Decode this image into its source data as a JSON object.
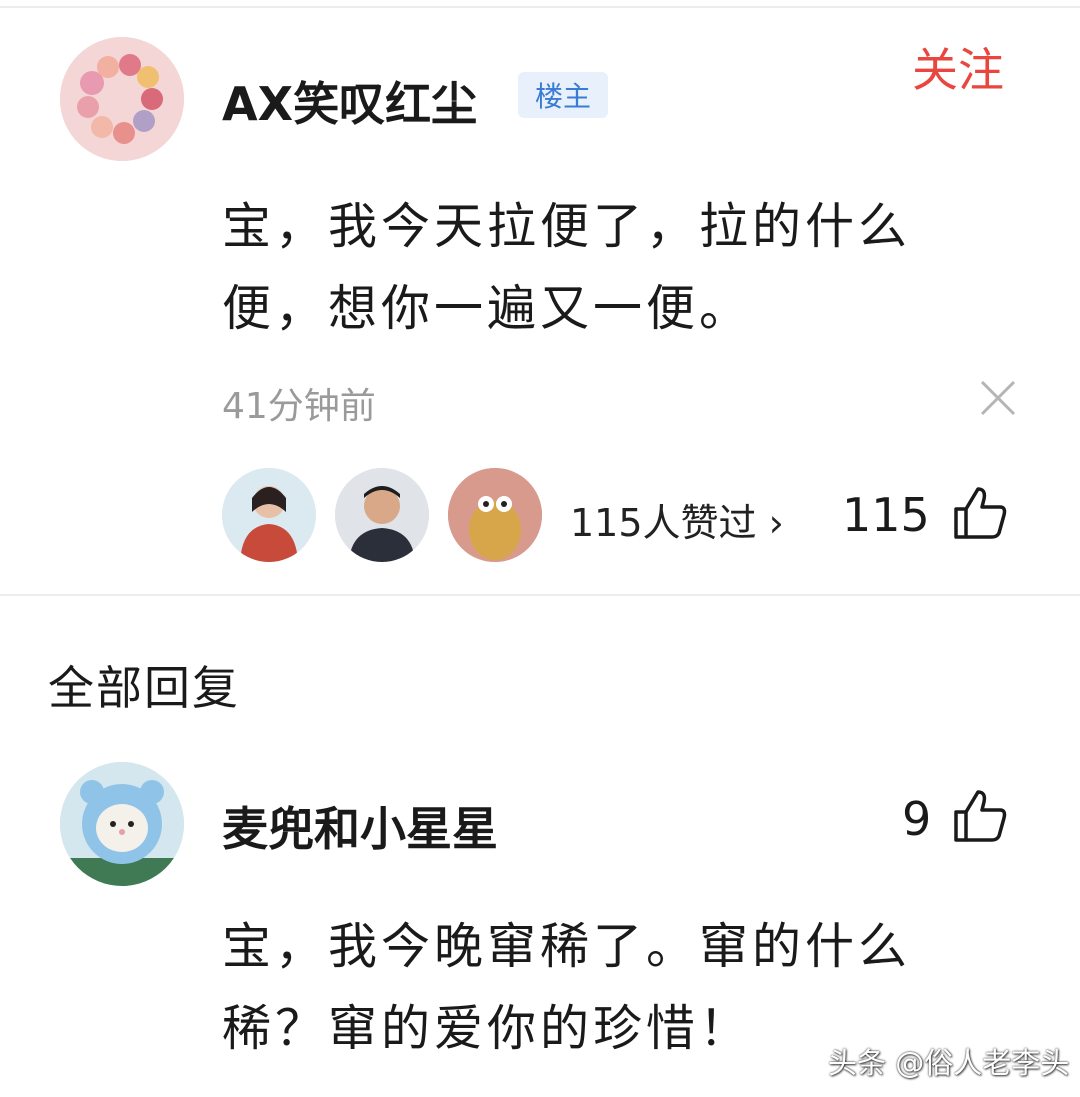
{
  "comment": {
    "username": "AX笑叹红尘",
    "badge": "楼主",
    "follow_label": "关注",
    "text": "宝，我今天拉便了，拉的什么便，想你一遍又一便。",
    "time": "41分钟前",
    "likers_text": "115人赞过 ›",
    "like_count": "115"
  },
  "replies": {
    "section_title": "全部回复",
    "items": [
      {
        "username": "麦兜和小星星",
        "like_count": "9",
        "text": "宝，我今晚窜稀了。窜的什么稀？窜的爱你的珍惜！"
      }
    ]
  },
  "watermark": "头条 @俗人老李头",
  "icons": [
    "close-icon",
    "thumbs-up-icon"
  ],
  "colors": {
    "follow": "#e8463f",
    "badge_text": "#3a7bd5",
    "badge_bg": "#e8f1fb",
    "muted": "#9a9a9a"
  }
}
